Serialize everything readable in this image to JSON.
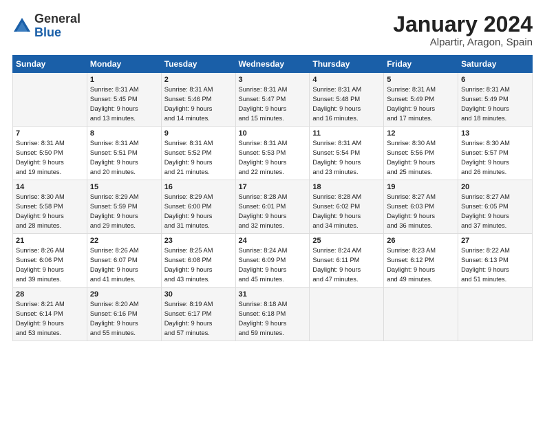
{
  "logo": {
    "general": "General",
    "blue": "Blue"
  },
  "title": "January 2024",
  "location": "Alpartir, Aragon, Spain",
  "days_header": [
    "Sunday",
    "Monday",
    "Tuesday",
    "Wednesday",
    "Thursday",
    "Friday",
    "Saturday"
  ],
  "weeks": [
    [
      {
        "num": "",
        "info": ""
      },
      {
        "num": "1",
        "info": "Sunrise: 8:31 AM\nSunset: 5:45 PM\nDaylight: 9 hours\nand 13 minutes."
      },
      {
        "num": "2",
        "info": "Sunrise: 8:31 AM\nSunset: 5:46 PM\nDaylight: 9 hours\nand 14 minutes."
      },
      {
        "num": "3",
        "info": "Sunrise: 8:31 AM\nSunset: 5:47 PM\nDaylight: 9 hours\nand 15 minutes."
      },
      {
        "num": "4",
        "info": "Sunrise: 8:31 AM\nSunset: 5:48 PM\nDaylight: 9 hours\nand 16 minutes."
      },
      {
        "num": "5",
        "info": "Sunrise: 8:31 AM\nSunset: 5:49 PM\nDaylight: 9 hours\nand 17 minutes."
      },
      {
        "num": "6",
        "info": "Sunrise: 8:31 AM\nSunset: 5:49 PM\nDaylight: 9 hours\nand 18 minutes."
      }
    ],
    [
      {
        "num": "7",
        "info": "Sunrise: 8:31 AM\nSunset: 5:50 PM\nDaylight: 9 hours\nand 19 minutes."
      },
      {
        "num": "8",
        "info": "Sunrise: 8:31 AM\nSunset: 5:51 PM\nDaylight: 9 hours\nand 20 minutes."
      },
      {
        "num": "9",
        "info": "Sunrise: 8:31 AM\nSunset: 5:52 PM\nDaylight: 9 hours\nand 21 minutes."
      },
      {
        "num": "10",
        "info": "Sunrise: 8:31 AM\nSunset: 5:53 PM\nDaylight: 9 hours\nand 22 minutes."
      },
      {
        "num": "11",
        "info": "Sunrise: 8:31 AM\nSunset: 5:54 PM\nDaylight: 9 hours\nand 23 minutes."
      },
      {
        "num": "12",
        "info": "Sunrise: 8:30 AM\nSunset: 5:56 PM\nDaylight: 9 hours\nand 25 minutes."
      },
      {
        "num": "13",
        "info": "Sunrise: 8:30 AM\nSunset: 5:57 PM\nDaylight: 9 hours\nand 26 minutes."
      }
    ],
    [
      {
        "num": "14",
        "info": "Sunrise: 8:30 AM\nSunset: 5:58 PM\nDaylight: 9 hours\nand 28 minutes."
      },
      {
        "num": "15",
        "info": "Sunrise: 8:29 AM\nSunset: 5:59 PM\nDaylight: 9 hours\nand 29 minutes."
      },
      {
        "num": "16",
        "info": "Sunrise: 8:29 AM\nSunset: 6:00 PM\nDaylight: 9 hours\nand 31 minutes."
      },
      {
        "num": "17",
        "info": "Sunrise: 8:28 AM\nSunset: 6:01 PM\nDaylight: 9 hours\nand 32 minutes."
      },
      {
        "num": "18",
        "info": "Sunrise: 8:28 AM\nSunset: 6:02 PM\nDaylight: 9 hours\nand 34 minutes."
      },
      {
        "num": "19",
        "info": "Sunrise: 8:27 AM\nSunset: 6:03 PM\nDaylight: 9 hours\nand 36 minutes."
      },
      {
        "num": "20",
        "info": "Sunrise: 8:27 AM\nSunset: 6:05 PM\nDaylight: 9 hours\nand 37 minutes."
      }
    ],
    [
      {
        "num": "21",
        "info": "Sunrise: 8:26 AM\nSunset: 6:06 PM\nDaylight: 9 hours\nand 39 minutes."
      },
      {
        "num": "22",
        "info": "Sunrise: 8:26 AM\nSunset: 6:07 PM\nDaylight: 9 hours\nand 41 minutes."
      },
      {
        "num": "23",
        "info": "Sunrise: 8:25 AM\nSunset: 6:08 PM\nDaylight: 9 hours\nand 43 minutes."
      },
      {
        "num": "24",
        "info": "Sunrise: 8:24 AM\nSunset: 6:09 PM\nDaylight: 9 hours\nand 45 minutes."
      },
      {
        "num": "25",
        "info": "Sunrise: 8:24 AM\nSunset: 6:11 PM\nDaylight: 9 hours\nand 47 minutes."
      },
      {
        "num": "26",
        "info": "Sunrise: 8:23 AM\nSunset: 6:12 PM\nDaylight: 9 hours\nand 49 minutes."
      },
      {
        "num": "27",
        "info": "Sunrise: 8:22 AM\nSunset: 6:13 PM\nDaylight: 9 hours\nand 51 minutes."
      }
    ],
    [
      {
        "num": "28",
        "info": "Sunrise: 8:21 AM\nSunset: 6:14 PM\nDaylight: 9 hours\nand 53 minutes."
      },
      {
        "num": "29",
        "info": "Sunrise: 8:20 AM\nSunset: 6:16 PM\nDaylight: 9 hours\nand 55 minutes."
      },
      {
        "num": "30",
        "info": "Sunrise: 8:19 AM\nSunset: 6:17 PM\nDaylight: 9 hours\nand 57 minutes."
      },
      {
        "num": "31",
        "info": "Sunrise: 8:18 AM\nSunset: 6:18 PM\nDaylight: 9 hours\nand 59 minutes."
      },
      {
        "num": "",
        "info": ""
      },
      {
        "num": "",
        "info": ""
      },
      {
        "num": "",
        "info": ""
      }
    ]
  ]
}
